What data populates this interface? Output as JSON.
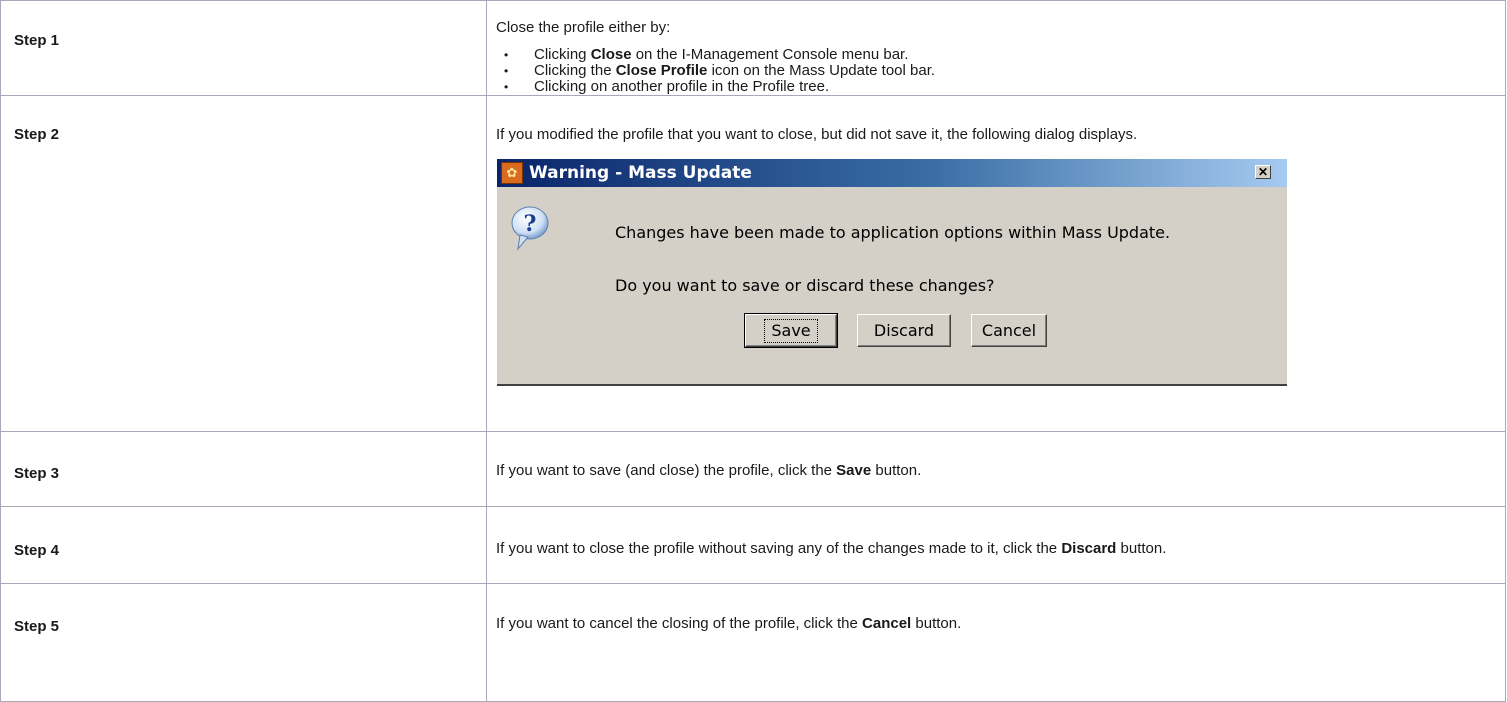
{
  "rows": [
    {
      "step": "Step 1",
      "intro": "Close the profile either by:",
      "bullets": [
        {
          "pre": "Clicking ",
          "bold": "Close",
          "post": " on the I-Management Console menu bar."
        },
        {
          "pre": "Clicking the ",
          "bold": "Close Profile",
          "post": " icon on the Mass Update tool bar."
        },
        {
          "pre": "Clicking on another profile in the Profile tree.",
          "bold": "",
          "post": ""
        }
      ]
    },
    {
      "step": "Step 2",
      "text": "If you modified the profile that you want to close, but did not save it, the following dialog displays."
    },
    {
      "step": "Step 3",
      "pre": "If you want to save (and close) the profile, click the ",
      "bold": "Save",
      "post": " button."
    },
    {
      "step": "Step 4",
      "pre": "If you want to close the profile without saving any of the changes made to it, click the ",
      "bold": "Discard",
      "post": " button."
    },
    {
      "step": "Step 5",
      "pre": "If you want to cancel the closing of the profile, click the ",
      "bold": "Cancel",
      "post": " button."
    }
  ],
  "dialog": {
    "title": "Warning - Mass Update",
    "message_line1": "Changes have been made to application options within Mass Update.",
    "message_line2": "Do you want to save or discard these changes?",
    "buttons": {
      "save": "Save",
      "discard": "Discard",
      "cancel": "Cancel"
    },
    "icons": {
      "app": "app-gear-icon",
      "question": "question-balloon-icon",
      "close": "close-icon"
    },
    "colors": {
      "title_start": "#0a246a",
      "title_end": "#a6caf0",
      "face": "#d4d0c8"
    }
  }
}
